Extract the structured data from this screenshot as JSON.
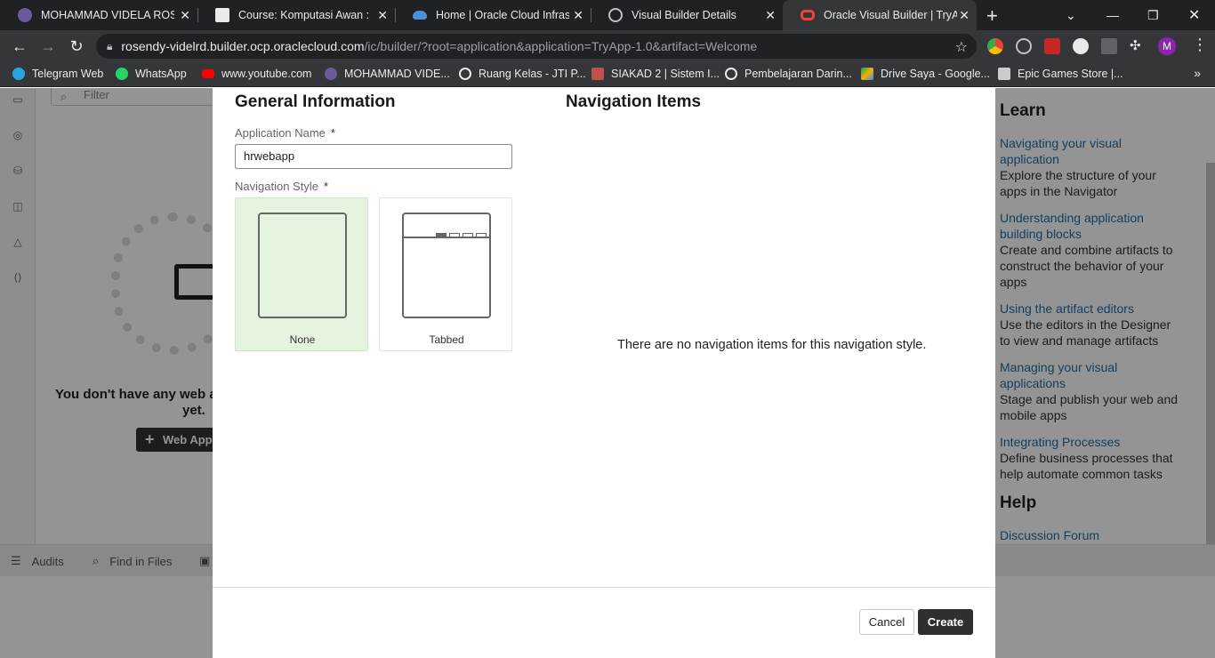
{
  "browser": {
    "tabs": [
      {
        "title": "MOHAMMAD VIDELA ROSENDY",
        "favicon": "university-seal-icon"
      },
      {
        "title": "Course: Komputasi Awan : Di",
        "favicon": "moodle-icon"
      },
      {
        "title": "Home | Oracle Cloud Infrastru",
        "favicon": "oracle-cloud-icon"
      },
      {
        "title": "Visual Builder Details",
        "favicon": "globe-icon"
      },
      {
        "title": "Oracle Visual Builder | TryApp",
        "favicon": "oracle-icon",
        "active": true
      }
    ],
    "url": {
      "host": "rosendy-videlrd.builder.ocp.oraclecloud.com",
      "path": "/ic/builder/?root=application&application=TryApp-1.0&artifact=Welcome"
    },
    "profile_initial": "M",
    "bookmarks": [
      {
        "label": "Telegram Web",
        "icon": "telegram-icon",
        "color": "#2aa3de"
      },
      {
        "label": "WhatsApp",
        "icon": "whatsapp-icon",
        "color": "#25d366"
      },
      {
        "label": "www.youtube.com",
        "icon": "youtube-icon",
        "color": "#ff0000"
      },
      {
        "label": "MOHAMMAD VIDE...",
        "icon": "university-seal-icon",
        "color": "#6b5a9c"
      },
      {
        "label": "Ruang Kelas - JTI P...",
        "icon": "globe-icon",
        "color": "#dddddd"
      },
      {
        "label": "SIAKAD 2 | Sistem I...",
        "icon": "siakad-icon",
        "color": "#c0504d"
      },
      {
        "label": "Pembelajaran Darin...",
        "icon": "globe-icon",
        "color": "#dddddd"
      },
      {
        "label": "Drive Saya - Google...",
        "icon": "google-drive-icon",
        "color": "#f4b400"
      },
      {
        "label": "Epic Games Store |...",
        "icon": "epic-games-icon",
        "color": "#cccccc"
      }
    ]
  },
  "background": {
    "filter_placeholder": "Filter",
    "empty_line1": "You don't have any web a",
    "empty_line2": "yet.",
    "web_app_button": "Web Appl",
    "bottom_tabs": [
      {
        "label": "Audits",
        "icon": "audits-icon"
      },
      {
        "label": "Find in Files",
        "icon": "search-icon"
      }
    ],
    "learn": {
      "heading": "Learn",
      "items": [
        {
          "link": "Navigating your visual application",
          "desc": "Explore the structure of your apps in the Navigator"
        },
        {
          "link": "Understanding application building blocks",
          "desc": "Create and combine artifacts to construct the behavior of your apps"
        },
        {
          "link": "Using the artifact editors",
          "desc": "Use the editors in the Designer to view and manage artifacts"
        },
        {
          "link": "Managing your visual applications",
          "desc": "Stage and publish your web and mobile apps"
        },
        {
          "link": "Integrating Processes",
          "desc": "Define business processes that help automate common tasks"
        }
      ],
      "help_heading": "Help",
      "help_link": "Discussion Forum"
    }
  },
  "dialog": {
    "general_title": "General Information",
    "app_name_label": "Application Name",
    "required_mark": "*",
    "app_name_value": "hrwebapp",
    "nav_style_label": "Navigation Style",
    "nav_options": [
      {
        "label": "None",
        "selected": true
      },
      {
        "label": "Tabbed",
        "selected": false
      }
    ],
    "nav_items_title": "Navigation Items",
    "no_items_text": "There are no navigation items for this navigation style.",
    "cancel_label": "Cancel",
    "create_label": "Create"
  },
  "colors": {
    "selected_option_bg": "#e5f4df",
    "primary_button": "#2f2f2f",
    "link": "#1f6ea8"
  }
}
